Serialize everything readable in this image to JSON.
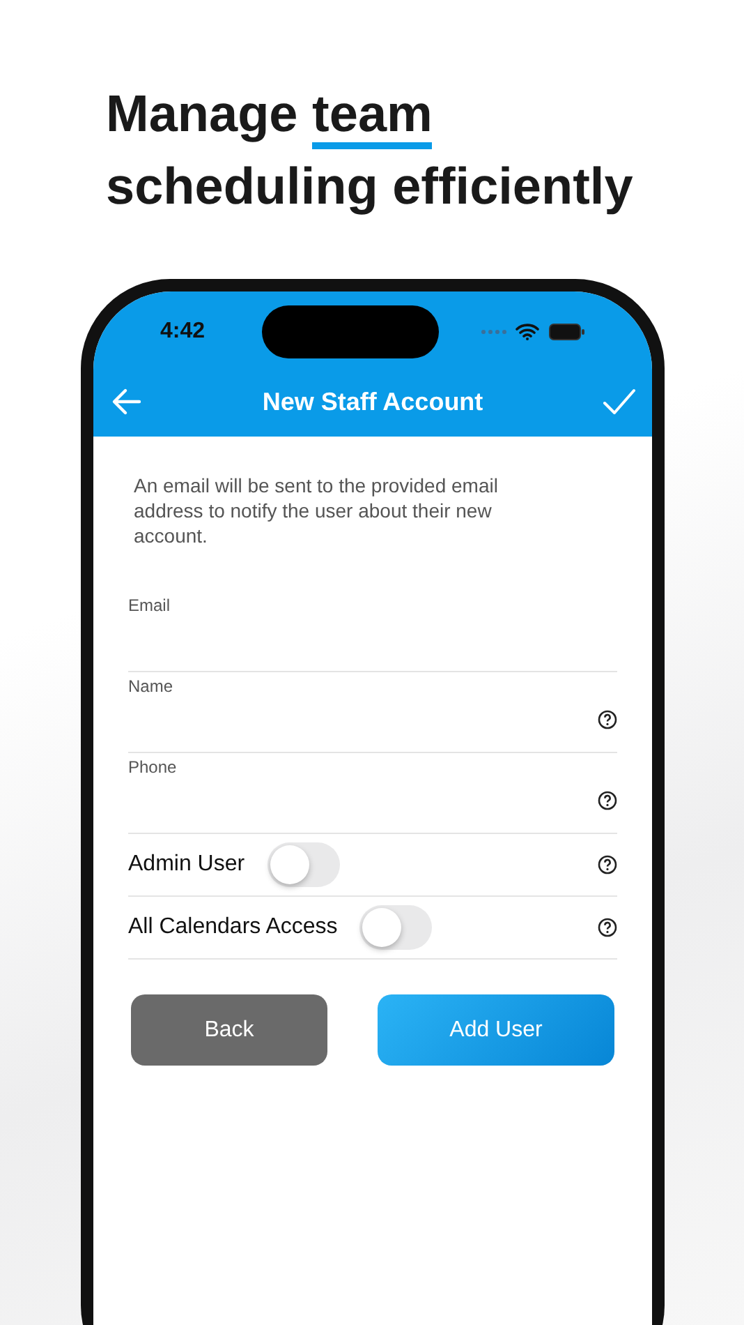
{
  "headline": {
    "before": "Manage ",
    "highlight": "team",
    "after": "scheduling efficiently"
  },
  "status_bar": {
    "time": "4:42"
  },
  "nav": {
    "title": "New Staff Account"
  },
  "description": "An email will be sent to the provided email address to notify the user about their new account.",
  "fields": [
    {
      "kind": "text",
      "label": "Email",
      "help": false
    },
    {
      "kind": "text",
      "label": "Name",
      "help": true
    },
    {
      "kind": "text",
      "label": "Phone",
      "help": true
    },
    {
      "kind": "toggle",
      "label": "Admin User",
      "on": false,
      "help": true
    },
    {
      "kind": "toggle",
      "label": "All Calendars Access",
      "on": false,
      "help": true
    }
  ],
  "buttons": [
    {
      "kind": "secondary",
      "label": "Back"
    },
    {
      "kind": "primary",
      "label": "Add User"
    }
  ]
}
